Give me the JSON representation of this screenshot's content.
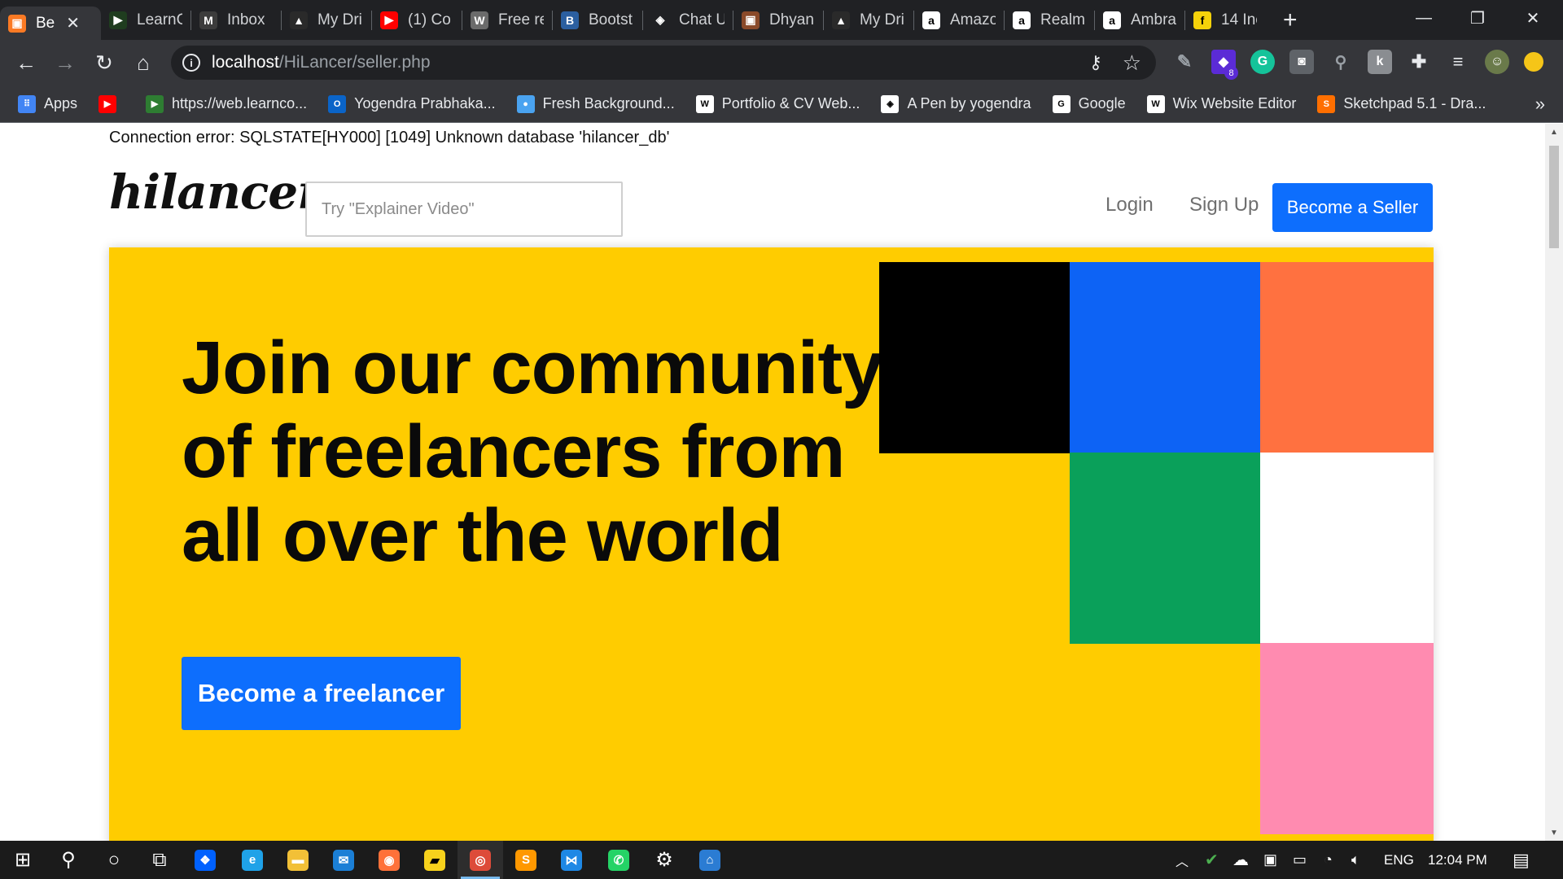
{
  "browser": {
    "tabs": [
      {
        "title": "Be",
        "fav": "xampp-icon",
        "color": "#fb7a24",
        "glyph": "▣",
        "active": true
      },
      {
        "title": "LearnC",
        "fav": "learncode-icon",
        "color": "#1f3d1f",
        "glyph": "▶"
      },
      {
        "title": "Inbox",
        "fav": "gmail-icon",
        "color": "#3c3c3c",
        "glyph": "M"
      },
      {
        "title": "My Dri",
        "fav": "drive-icon",
        "color": "#2a2a2a",
        "glyph": "▲"
      },
      {
        "title": "(1) Co",
        "fav": "youtube-icon",
        "color": "#ff0000",
        "glyph": "▶"
      },
      {
        "title": "Free re",
        "fav": "wordpress-icon",
        "color": "#6b6b6b",
        "glyph": "W"
      },
      {
        "title": "Bootst",
        "fav": "bootstrap-icon",
        "color": "#2b5fa0",
        "glyph": "B"
      },
      {
        "title": "Chat U",
        "fav": "codepen-icon",
        "color": "#202124",
        "glyph": "◈"
      },
      {
        "title": "Dhyan",
        "fav": "xampp-icon",
        "color": "#8a4a2a",
        "glyph": "▣"
      },
      {
        "title": "My Dri",
        "fav": "drive-icon",
        "color": "#2a2a2a",
        "glyph": "▲"
      },
      {
        "title": "Amazo",
        "fav": "amazon-icon",
        "color": "#ffffff",
        "glyph": "a"
      },
      {
        "title": "Realm",
        "fav": "amazon-icon",
        "color": "#ffffff",
        "glyph": "a"
      },
      {
        "title": "Ambra",
        "fav": "amazon-icon",
        "color": "#ffffff",
        "glyph": "a"
      },
      {
        "title": "14 Inc",
        "fav": "flipkart-icon",
        "color": "#f5d20a",
        "glyph": "f"
      }
    ],
    "new_tab": "+",
    "window": {
      "minimize": "—",
      "restore": "❐",
      "close": "✕"
    },
    "url_host": "localhost",
    "url_path": "/HiLancer/seller.php",
    "bookmarks": [
      {
        "label": "Apps",
        "icon": "apps-grid-icon",
        "color": "#4285f4"
      },
      {
        "label": "",
        "icon": "youtube-icon",
        "color": "#ff0000"
      },
      {
        "label": "https://web.learnco...",
        "icon": "learncode-icon",
        "color": "#2e7d32"
      },
      {
        "label": "Yogendra Prabhaka...",
        "icon": "outlook-icon",
        "color": "#0a64c8"
      },
      {
        "label": "Fresh Background...",
        "icon": "fresh-bg-icon",
        "color": "#4aa3f0"
      },
      {
        "label": "Portfolio & CV Web...",
        "icon": "wix-icon",
        "color": "#ffffff"
      },
      {
        "label": "A Pen by yogendra",
        "icon": "codepen-icon",
        "color": "#ffffff"
      },
      {
        "label": "Google",
        "icon": "google-icon",
        "color": "#ffffff"
      },
      {
        "label": "Wix Website Editor",
        "icon": "wix-icon",
        "color": "#ffffff"
      },
      {
        "label": "Sketchpad 5.1 - Dra...",
        "icon": "sketchpad-icon",
        "color": "#ff6f00"
      }
    ],
    "bookmarks_more": "»",
    "extension_badge": "8"
  },
  "page": {
    "error_text": "Connection error: SQLSTATE[HY000] [1049] Unknown database 'hilancer_db'",
    "logo_text": "hilancer",
    "search_placeholder": "Try \"Explainer Video\"",
    "nav": {
      "login": "Login",
      "signup": "Sign Up",
      "become_seller": "Become a Seller"
    },
    "hero": {
      "title": "Join our community of freelancers from all over the world",
      "cta": "Become a freelancer"
    },
    "colors": {
      "hero_bg": "#ffcc00",
      "primary": "#0d6efd",
      "black_tile": "#000000",
      "blue_tile": "#0d63f5",
      "orange_tile": "#ff7140",
      "green_tile": "#0aa05a",
      "white_tile": "#ffffff",
      "pink_tile": "#ff8bb0"
    }
  },
  "taskbar": {
    "apps": [
      {
        "name": "windows-start-icon",
        "glyph": "⊞"
      },
      {
        "name": "search-icon",
        "glyph": "⚲"
      },
      {
        "name": "cortana-icon",
        "glyph": "○"
      },
      {
        "name": "task-view-icon",
        "glyph": "⧉"
      },
      {
        "name": "dropbox-icon",
        "glyph": "❖"
      },
      {
        "name": "edge-icon",
        "glyph": "e"
      },
      {
        "name": "file-explorer-icon",
        "glyph": "▬"
      },
      {
        "name": "mail-icon",
        "glyph": "✉"
      },
      {
        "name": "firefox-icon",
        "glyph": "◉"
      },
      {
        "name": "sticky-notes-icon",
        "glyph": "▰"
      },
      {
        "name": "chrome-icon",
        "glyph": "◎"
      },
      {
        "name": "sublime-text-icon",
        "glyph": "S"
      },
      {
        "name": "vscode-icon",
        "glyph": "⋈"
      },
      {
        "name": "whatsapp-icon",
        "glyph": "✆"
      },
      {
        "name": "settings-gear-icon",
        "glyph": "⚙"
      },
      {
        "name": "store-icon",
        "glyph": "⌂"
      }
    ],
    "language": "ENG",
    "time": "12:04 PM"
  }
}
